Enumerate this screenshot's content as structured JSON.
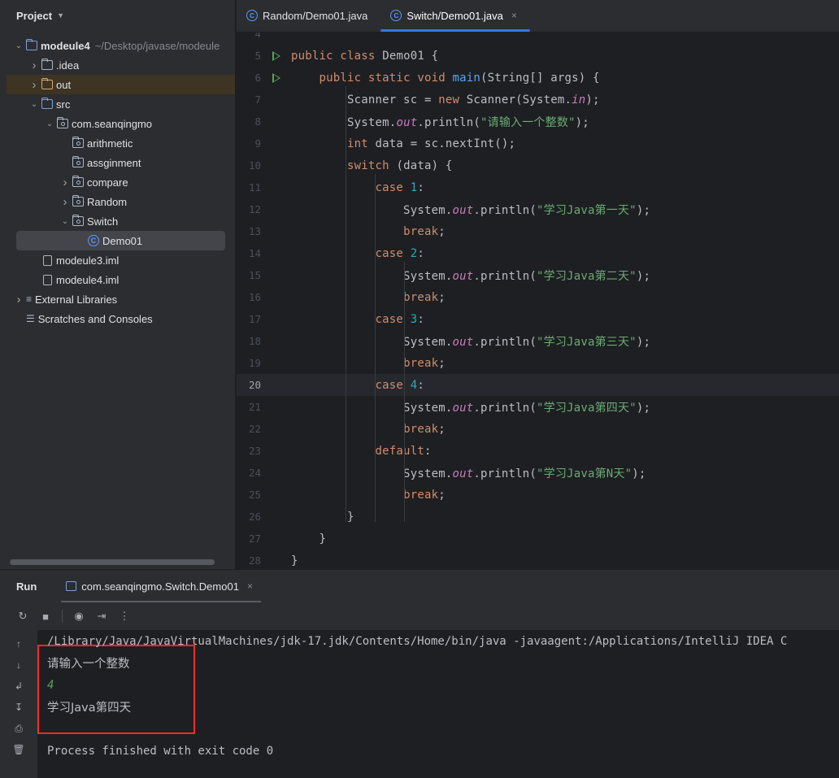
{
  "project": {
    "title": "Project",
    "tree": [
      {
        "label": "modeule4",
        "path": "~/Desktop/javase/modeule",
        "depth": 0,
        "arrow": "open",
        "icon": "module",
        "bold": true
      },
      {
        "label": ".idea",
        "depth": 1,
        "arrow": "closed",
        "icon": "folder"
      },
      {
        "label": "out",
        "depth": 1,
        "arrow": "closed",
        "icon": "folder-orange",
        "highlight": true
      },
      {
        "label": "src",
        "depth": 1,
        "arrow": "open",
        "icon": "folder-blue"
      },
      {
        "label": "com.seanqingmo",
        "depth": 2,
        "arrow": "open",
        "icon": "package"
      },
      {
        "label": "arithmetic",
        "depth": 3,
        "arrow": "none",
        "icon": "package"
      },
      {
        "label": "assginment",
        "depth": 3,
        "arrow": "none",
        "icon": "package"
      },
      {
        "label": "compare",
        "depth": 3,
        "arrow": "closed",
        "icon": "package"
      },
      {
        "label": "Random",
        "depth": 3,
        "arrow": "closed",
        "icon": "package"
      },
      {
        "label": "Switch",
        "depth": 3,
        "arrow": "open",
        "icon": "package"
      },
      {
        "label": "Demo01",
        "depth": 4,
        "arrow": "none",
        "icon": "class",
        "selected": true
      },
      {
        "label": "modeule3.iml",
        "depth": 1,
        "arrow": "none",
        "icon": "iml"
      },
      {
        "label": "modeule4.iml",
        "depth": 1,
        "arrow": "none",
        "icon": "iml"
      },
      {
        "label": "External Libraries",
        "depth": 0,
        "arrow": "closed",
        "icon": "library"
      },
      {
        "label": "Scratches and Consoles",
        "depth": 0,
        "arrow": "none",
        "icon": "scratches"
      }
    ]
  },
  "editor": {
    "tabs": [
      {
        "label": "Random/Demo01.java",
        "active": false
      },
      {
        "label": "Switch/Demo01.java",
        "active": true,
        "close": "×"
      }
    ],
    "current_line": "20",
    "lines": [
      {
        "n": "4",
        "tokens": []
      },
      {
        "n": "5",
        "run": true,
        "tokens": [
          [
            "kw",
            "public "
          ],
          [
            "kw",
            "class "
          ],
          [
            "t",
            "Demo01 {"
          ]
        ]
      },
      {
        "n": "6",
        "run": true,
        "tokens": [
          [
            "t",
            "    "
          ],
          [
            "kw",
            "public "
          ],
          [
            "kw",
            "static "
          ],
          [
            "kw",
            "void "
          ],
          [
            "fn",
            "main"
          ],
          [
            "t",
            "(String[] args) {"
          ]
        ]
      },
      {
        "n": "7",
        "tokens": [
          [
            "t",
            "        Scanner sc = "
          ],
          [
            "kw",
            "new "
          ],
          [
            "t",
            "Scanner(System."
          ],
          [
            "field",
            "in"
          ],
          [
            "t",
            ");"
          ]
        ]
      },
      {
        "n": "8",
        "tokens": [
          [
            "t",
            "        System."
          ],
          [
            "field",
            "out"
          ],
          [
            "t",
            ".println("
          ],
          [
            "str",
            "\"请输入一个整数\""
          ],
          [
            "t",
            ");"
          ]
        ]
      },
      {
        "n": "9",
        "tokens": [
          [
            "t",
            "        "
          ],
          [
            "kw",
            "int "
          ],
          [
            "t",
            "data = sc.nextInt();"
          ]
        ]
      },
      {
        "n": "10",
        "tokens": [
          [
            "t",
            "        "
          ],
          [
            "kw",
            "switch "
          ],
          [
            "t",
            "(data) {"
          ]
        ]
      },
      {
        "n": "11",
        "tokens": [
          [
            "t",
            "            "
          ],
          [
            "kw",
            "case "
          ],
          [
            "num",
            "1"
          ],
          [
            "t",
            ":"
          ]
        ]
      },
      {
        "n": "12",
        "tokens": [
          [
            "t",
            "                System."
          ],
          [
            "field",
            "out"
          ],
          [
            "t",
            ".println("
          ],
          [
            "str",
            "\"学习Java第一天\""
          ],
          [
            "t",
            ");"
          ]
        ]
      },
      {
        "n": "13",
        "tokens": [
          [
            "t",
            "                "
          ],
          [
            "kw",
            "break"
          ],
          [
            "t",
            ";"
          ]
        ]
      },
      {
        "n": "14",
        "tokens": [
          [
            "t",
            "            "
          ],
          [
            "kw",
            "case "
          ],
          [
            "num",
            "2"
          ],
          [
            "t",
            ":"
          ]
        ]
      },
      {
        "n": "15",
        "tokens": [
          [
            "t",
            "                System."
          ],
          [
            "field",
            "out"
          ],
          [
            "t",
            ".println("
          ],
          [
            "str",
            "\"学习Java第二天\""
          ],
          [
            "t",
            ");"
          ]
        ]
      },
      {
        "n": "16",
        "tokens": [
          [
            "t",
            "                "
          ],
          [
            "kw",
            "break"
          ],
          [
            "t",
            ";"
          ]
        ]
      },
      {
        "n": "17",
        "tokens": [
          [
            "t",
            "            "
          ],
          [
            "kw",
            "case "
          ],
          [
            "num",
            "3"
          ],
          [
            "t",
            ":"
          ]
        ]
      },
      {
        "n": "18",
        "tokens": [
          [
            "t",
            "                System."
          ],
          [
            "field",
            "out"
          ],
          [
            "t",
            ".println("
          ],
          [
            "str",
            "\"学习Java第三天\""
          ],
          [
            "t",
            ");"
          ]
        ]
      },
      {
        "n": "19",
        "tokens": [
          [
            "t",
            "                "
          ],
          [
            "kw",
            "break"
          ],
          [
            "t",
            ";"
          ]
        ]
      },
      {
        "n": "20",
        "tokens": [
          [
            "t",
            "            "
          ],
          [
            "kw",
            "case "
          ],
          [
            "num",
            "4"
          ],
          [
            "t",
            ":"
          ]
        ]
      },
      {
        "n": "21",
        "tokens": [
          [
            "t",
            "                System."
          ],
          [
            "field",
            "out"
          ],
          [
            "t",
            ".println("
          ],
          [
            "str",
            "\"学习Java第四天\""
          ],
          [
            "t",
            ");"
          ]
        ]
      },
      {
        "n": "22",
        "tokens": [
          [
            "t",
            "                "
          ],
          [
            "kw",
            "break"
          ],
          [
            "t",
            ";"
          ]
        ]
      },
      {
        "n": "23",
        "tokens": [
          [
            "t",
            "            "
          ],
          [
            "kw",
            "default"
          ],
          [
            "t",
            ":"
          ]
        ]
      },
      {
        "n": "24",
        "tokens": [
          [
            "t",
            "                System."
          ],
          [
            "field",
            "out"
          ],
          [
            "t",
            ".println("
          ],
          [
            "str",
            "\"学习Java第N天\""
          ],
          [
            "t",
            ");"
          ]
        ]
      },
      {
        "n": "25",
        "tokens": [
          [
            "t",
            "                "
          ],
          [
            "kw",
            "break"
          ],
          [
            "t",
            ";"
          ]
        ]
      },
      {
        "n": "26",
        "tokens": [
          [
            "t",
            "        }"
          ]
        ]
      },
      {
        "n": "27",
        "tokens": [
          [
            "t",
            "    }"
          ]
        ]
      },
      {
        "n": "28",
        "tokens": [
          [
            "t",
            "}"
          ]
        ]
      }
    ]
  },
  "run": {
    "title": "Run",
    "tab_label": "com.seanqingmo.Switch.Demo01",
    "tab_close": "×",
    "console": [
      {
        "text": "/Library/Java/JavaVirtualMachines/jdk-17.jdk/Contents/Home/bin/java -javaagent:/Applications/IntelliJ IDEA C",
        "kind": "cmd"
      },
      {
        "text": "请输入一个整数",
        "kind": "cjk"
      },
      {
        "text": "4",
        "kind": "input"
      },
      {
        "text": "学习Java第四天",
        "kind": "cjk"
      },
      {
        "text": "",
        "kind": "blank"
      },
      {
        "text": "Process finished with exit code 0",
        "kind": "normal"
      }
    ]
  },
  "colors": {
    "accent": "#3574f0",
    "run_green": "#57a55a",
    "highlight_box": "#ff2a2a"
  }
}
